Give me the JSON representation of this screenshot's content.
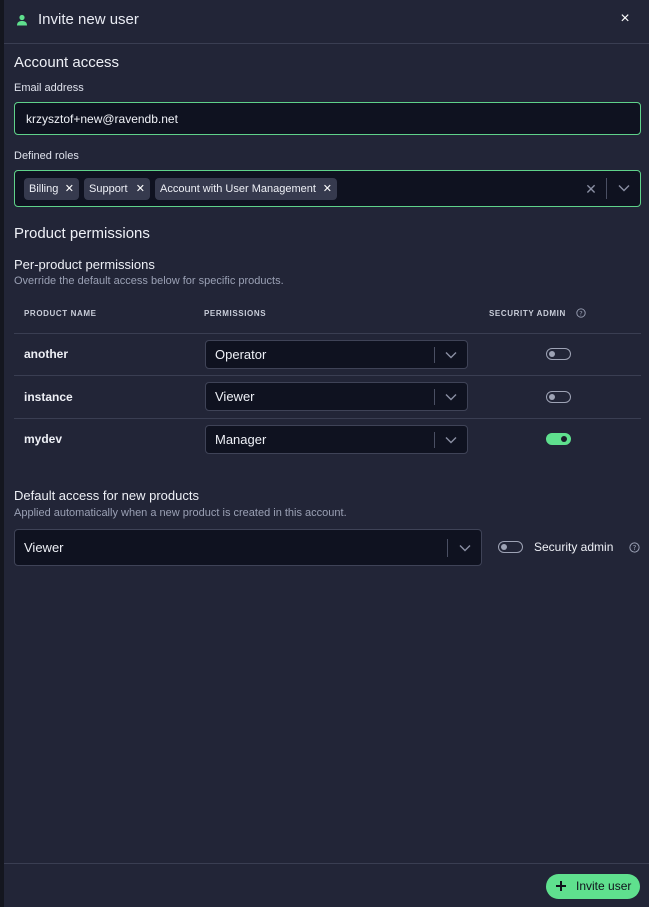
{
  "dialog": {
    "title": "Invite new user",
    "close_label": "×"
  },
  "account_access": {
    "heading": "Account access",
    "email_label": "Email address",
    "email_value": "krzysztof+new@ravendb.net",
    "roles_label": "Defined roles",
    "roles": [
      "Billing",
      "Support",
      "Account with User Management"
    ]
  },
  "product_permissions": {
    "heading": "Product permissions",
    "subheading": "Per-product permissions",
    "description": "Override the default access below for specific products.",
    "columns": {
      "product": "PRODUCT NAME",
      "permissions": "PERMISSIONS",
      "security_admin": "SECURITY ADMIN"
    },
    "rows": [
      {
        "name": "another",
        "permission": "Operator",
        "security_admin": false
      },
      {
        "name": "instance",
        "permission": "Viewer",
        "security_admin": false
      },
      {
        "name": "mydev",
        "permission": "Manager",
        "security_admin": true
      }
    ]
  },
  "default_access": {
    "heading": "Default access for new products",
    "description": "Applied automatically when a new product is created in this account.",
    "permission": "Viewer",
    "security_admin_label": "Security admin",
    "security_admin": false
  },
  "footer": {
    "invite_label": "Invite user"
  },
  "colors": {
    "accent": "#5fe08e",
    "panel_bg": "#222537",
    "input_bg": "#0f1220",
    "focus_border": "#5fd28a"
  },
  "icons": {
    "header": "user-icon",
    "close": "close-icon",
    "chevron": "chevron-down-icon",
    "help": "help-circle-icon",
    "invite": "plus-icon"
  }
}
